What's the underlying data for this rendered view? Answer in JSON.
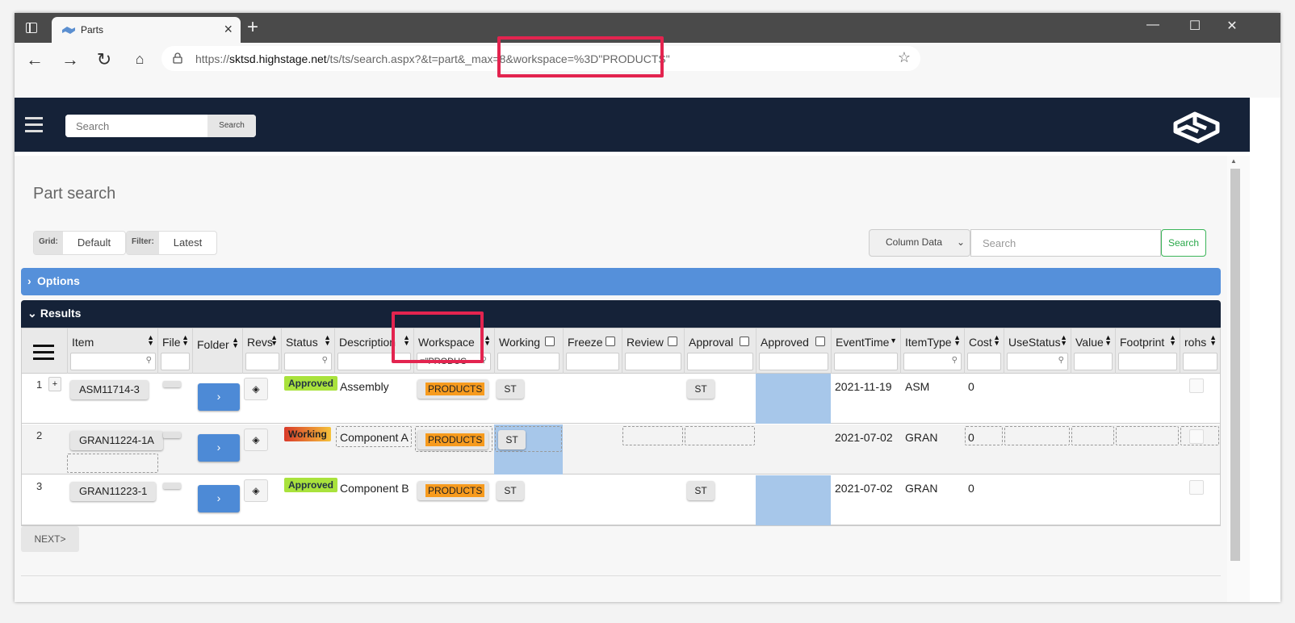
{
  "browser": {
    "tab_title": "Parts",
    "url_prefix": "https://",
    "url_host": "sktsd.highstage.net",
    "url_path": "/ts/ts/search.aspx?&t=part&_max=8&workspace=%3D\"PRODUCTS\"",
    "new_tab": "+",
    "minimize": "—",
    "maximize": "☐",
    "close": "✕"
  },
  "header": {
    "search_placeholder": "Search",
    "search_button": "Search"
  },
  "page": {
    "title": "Part search",
    "grid_label": "Grid:",
    "grid_value": "Default",
    "filter_label": "Filter:",
    "filter_value": "Latest",
    "column_select": "Column Data",
    "column_search_placeholder": "Search",
    "column_search_button": "Search",
    "options_label": "Options",
    "results_label": "Results",
    "next_button": "NEXT>"
  },
  "columns": {
    "item": "Item",
    "file": "File",
    "folder": "Folder",
    "revs": "Revs",
    "status": "Status",
    "description": "Description",
    "workspace": "Workspace",
    "workspace_filter": "=\"PRODUC",
    "working": "Working",
    "freeze": "Freeze",
    "review": "Review",
    "approval": "Approval",
    "approved": "Approved",
    "eventtime": "EventTime",
    "itemtype": "ItemType",
    "cost": "Cost",
    "usestatus": "UseStatus",
    "value": "Value",
    "footprint": "Footprint",
    "rohs": "rohs"
  },
  "rows": [
    {
      "num": "1",
      "plus": "+",
      "item": "ASM11714-3",
      "status": "Approved",
      "description": "Assembly",
      "workspace": "PRODUCTS",
      "working": "ST",
      "approval": "ST",
      "eventtime": "2021-11-19",
      "itemtype": "ASM",
      "cost": "0"
    },
    {
      "num": "2",
      "item": "GRAN11224-1A",
      "status": "Working",
      "description": "Component A",
      "workspace": "PRODUCTS",
      "working": "ST",
      "eventtime": "2021-07-02",
      "itemtype": "GRAN",
      "cost": "0"
    },
    {
      "num": "3",
      "item": "GRAN11223-1",
      "status": "Approved",
      "description": "Component B",
      "workspace": "PRODUCTS",
      "working": "ST",
      "approval": "ST",
      "eventtime": "2021-07-02",
      "itemtype": "GRAN",
      "cost": "0"
    }
  ],
  "colors": {
    "header_bg": "#152238",
    "options_bg": "#5590da",
    "highlight": "#e3244f",
    "workspace_badge": "#f79b1e",
    "approved_badge": "#a9e23c"
  },
  "icons": [
    "tab-actions-icon",
    "highstage-favicon",
    "back-icon",
    "forward-icon",
    "refresh-icon",
    "home-icon",
    "lock-icon",
    "favorites-icon",
    "menu-icon",
    "logo",
    "sort-icon",
    "magnifier-icon",
    "chevron-right-icon",
    "layers-icon"
  ]
}
